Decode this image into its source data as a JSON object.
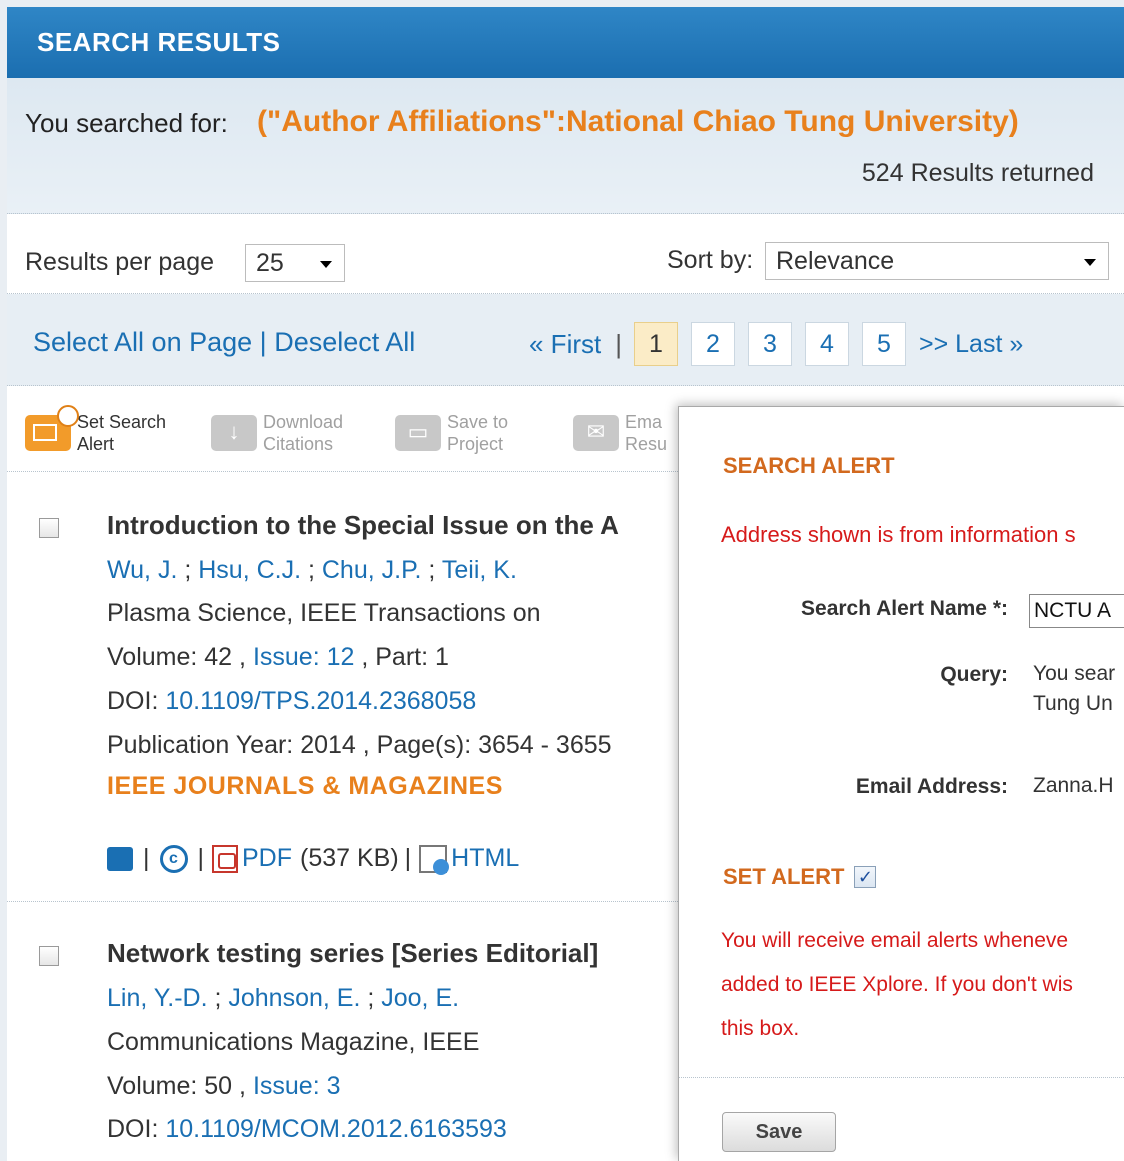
{
  "header": {
    "title": "SEARCH RESULTS"
  },
  "search": {
    "label": "You searched for:",
    "query": "(\"Author Affiliations\":National Chiao Tung University)",
    "count": "524 Results returned"
  },
  "controls": {
    "results_per_page_label": "Results per page",
    "results_per_page_value": "25",
    "sort_label": "Sort by:",
    "sort_value": "Relevance"
  },
  "selection": {
    "select_all": "Select All on Page",
    "separator": "|",
    "deselect_all": "Deselect All"
  },
  "pagination": {
    "first": "« First",
    "bar": "|",
    "pages": [
      "1",
      "2",
      "3",
      "4",
      "5"
    ],
    "current": "1",
    "last": ">> Last »"
  },
  "toolbar": {
    "set_alert": [
      "Set Search",
      "Alert"
    ],
    "download": [
      "Download",
      "Citations"
    ],
    "save_project": [
      "Save to",
      "Project"
    ],
    "email": [
      "Ema",
      "Resu"
    ]
  },
  "results": [
    {
      "title": "Introduction to the Special Issue on the A",
      "authors": [
        "Wu, J.",
        "Hsu, C.J.",
        "Chu, J.P.",
        "Teii, K."
      ],
      "journal": "Plasma Science, IEEE Transactions on",
      "volume_label": "Volume: 42 ,",
      "issue": "Issue: 12",
      "part": ", Part: 1",
      "doi_label": "DOI:",
      "doi": "10.1109/TPS.2014.2368058",
      "pubinfo": "Publication Year: 2014 , Page(s): 3654 - 3655",
      "type": "IEEE JOURNALS & MAGAZINES",
      "pdf": "PDF",
      "pdf_size": "(537 KB)",
      "html": "HTML",
      "sep": "|"
    },
    {
      "title": "Network testing series [Series Editorial]",
      "authors": [
        "Lin, Y.-D.",
        "Johnson, E.",
        "Joo, E."
      ],
      "journal": "Communications Magazine, IEEE",
      "volume_label": "Volume: 50 ,",
      "issue": "Issue: 3",
      "doi_label": "DOI:",
      "doi": "10.1109/MCOM.2012.6163593"
    }
  ],
  "author_sep": " ; ",
  "modal": {
    "title": "SEARCH ALERT",
    "notice": "Address shown is from information s",
    "name_label": "Search Alert Name *:",
    "name_value": "NCTU A",
    "query_label": "Query:",
    "query_line1": "You sear",
    "query_line2": "Tung Un",
    "email_label": "Email Address:",
    "email_value": "Zanna.H",
    "set_alert_label": "SET ALERT",
    "set_alert_check": "✓",
    "info_line1": "You will receive email alerts wheneve",
    "info_line2": "added to IEEE Xplore. If you don't wis",
    "info_line3": "this box.",
    "save": "Save"
  },
  "colors": {
    "accent": "#e8801c",
    "link": "#1a6fb3",
    "header": "#1b6eb0",
    "alert_red": "#d61a1a"
  }
}
